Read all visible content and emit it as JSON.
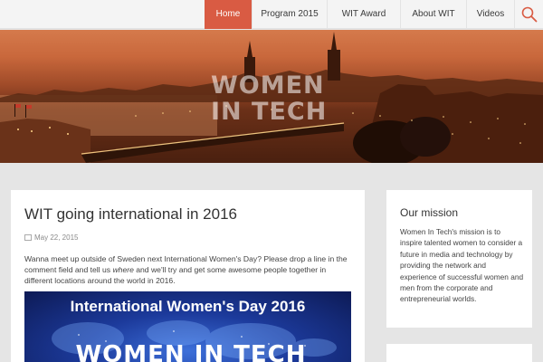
{
  "nav": {
    "items": [
      {
        "label": "Home",
        "active": true
      },
      {
        "label": "Program 2015"
      },
      {
        "label": "WIT Award"
      },
      {
        "label": "About WIT"
      },
      {
        "label": "Videos"
      }
    ],
    "search_icon": "search-icon"
  },
  "hero": {
    "title_line1": "WOMEN",
    "title_line2": "IN TECH"
  },
  "post": {
    "title": "WIT going international in 2016",
    "date": "May 22, 2015",
    "body_part1": "Wanna meet up outside of Sweden next International Women's Day? Please drop a line in the comment field and tell us ",
    "body_em": "where",
    "body_part2": " and we'll try and get some awesome people together in different locations around the world in 2016.",
    "image_title": "International Women's Day 2016",
    "image_subtitle": "WOMEN IN TECH"
  },
  "sidebar": {
    "widget_title": "Our mission",
    "widget_body": "Women In Tech's mission is to inspire talented women to consider a future in media and technology by providing the network and experience of successful women and men from the corporate and entrepreneurial worlds."
  },
  "colors": {
    "accent": "#d95b43",
    "background": "#e5e5e5"
  }
}
